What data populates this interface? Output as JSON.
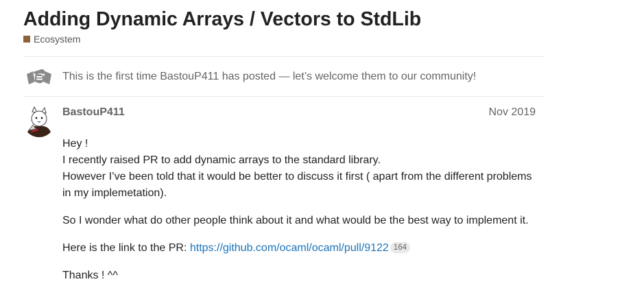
{
  "topic": {
    "title": "Adding Dynamic Arrays / Vectors to StdLib",
    "category": {
      "name": "Ecosystem",
      "color": "#8c6238"
    }
  },
  "notice": {
    "icon": "hands-clasp-icon",
    "text": "This is the first time BastouP411 has posted — let’s welcome them to our community!"
  },
  "post": {
    "author": "BastouP411",
    "date": "Nov 2019",
    "avatar_icon": "cat-avatar-icon",
    "greeting": "Hey !",
    "para1_line1": "I recently raised PR to add dynamic arrays to the standard library.",
    "para1_line2": "However I’ve been told that it would be better to discuss it first ( apart from the different problems in my implemetation).",
    "para2": "So I wonder what do other people think about it and what would be the best way to implement it.",
    "para3_prefix": "Here is the link to the PR: ",
    "pr_link": "https://github.com/ocaml/ocaml/pull/9122",
    "pr_link_clicks": "164",
    "closing": "Thanks ! ^^"
  }
}
